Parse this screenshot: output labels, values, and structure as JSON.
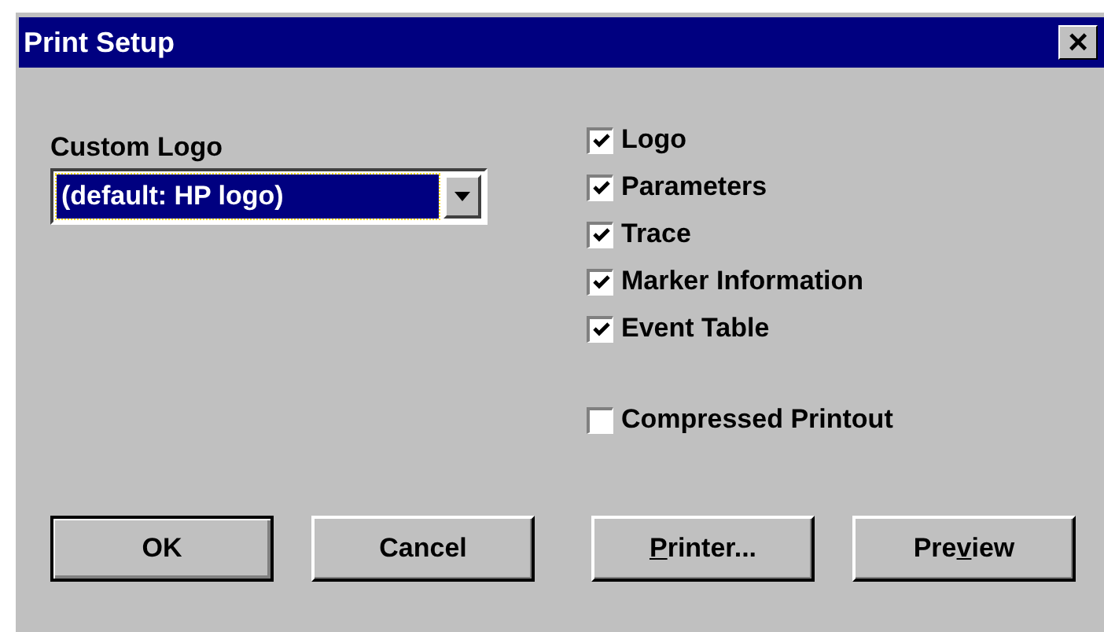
{
  "window": {
    "title": "Print Setup",
    "close": "×"
  },
  "custom_logo": {
    "label": "Custom Logo",
    "value": "(default: HP logo)",
    "focused": true
  },
  "options": [
    {
      "label": "Logo",
      "checked": true
    },
    {
      "label": "Parameters",
      "checked": true
    },
    {
      "label": "Trace",
      "checked": true
    },
    {
      "label": "Marker Information",
      "checked": true
    },
    {
      "label": "Event Table",
      "checked": true
    }
  ],
  "extra_option": {
    "label": "Compressed Printout",
    "checked": false
  },
  "buttons": [
    {
      "pre": "OK",
      "default": true
    },
    {
      "pre": "Cancel",
      "default": false
    },
    {
      "key": "P",
      "post": "rinter...",
      "default": false
    },
    {
      "pre": "Pre",
      "key": "v",
      "post": "iew",
      "default": false
    }
  ]
}
